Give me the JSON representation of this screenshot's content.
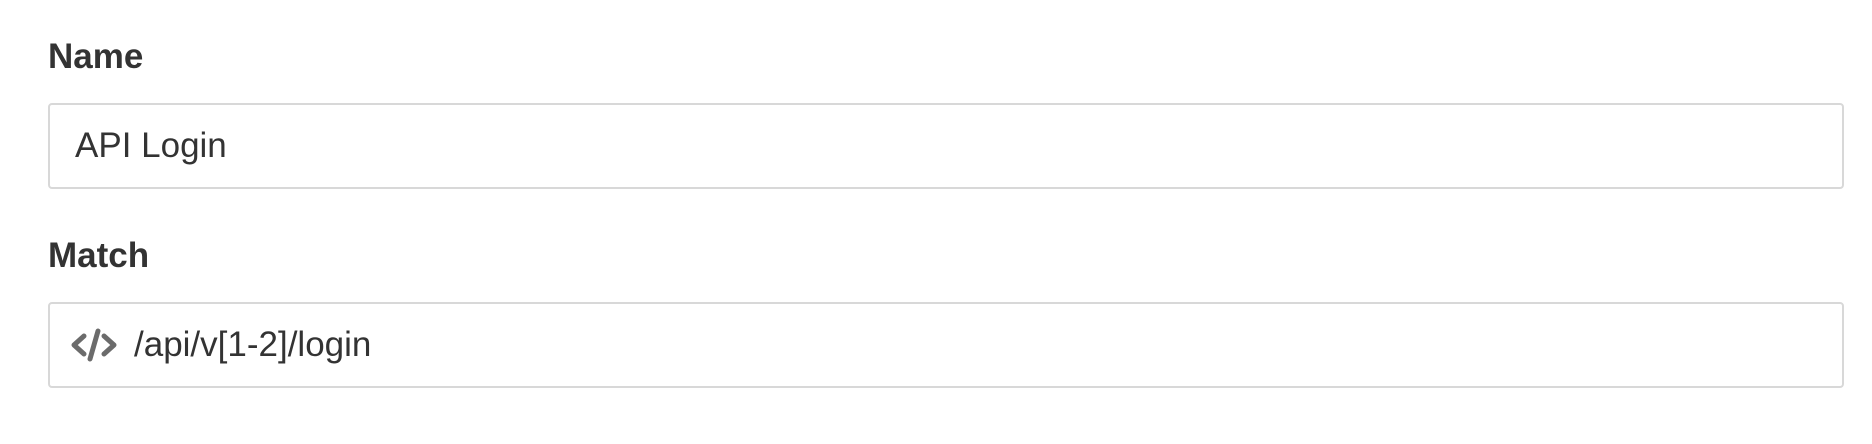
{
  "form": {
    "name_field": {
      "label": "Name",
      "value": "API Login"
    },
    "match_field": {
      "label": "Match",
      "icon": "code-icon",
      "value": "/api/v[1-2]/login"
    }
  },
  "colors": {
    "text": "#333333",
    "border": "#d8d8d8",
    "icon": "#6b6b6b"
  }
}
